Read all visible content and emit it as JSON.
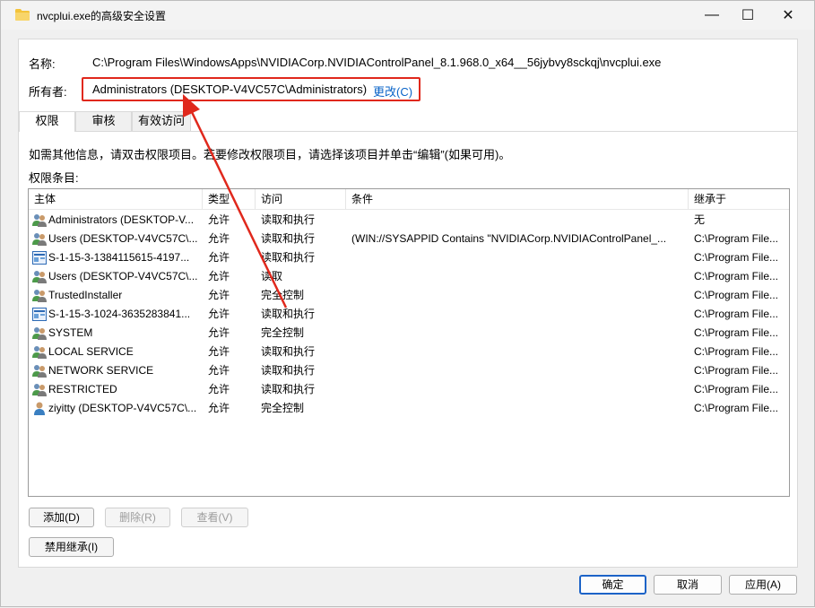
{
  "window": {
    "title": "nvcplui.exe的高级安全设置",
    "minimize": "—",
    "maximize": "☐",
    "close": "✕"
  },
  "header": {
    "name_label": "名称:",
    "name_value": "C:\\Program Files\\WindowsApps\\NVIDIACorp.NVIDIAControlPanel_8.1.968.0_x64__56jybvy8sckqj\\nvcplui.exe",
    "owner_label": "所有者:",
    "owner_value": "Administrators (DESKTOP-V4VC57C\\Administrators)",
    "change_link": "更改(C)"
  },
  "tabs": [
    "权限",
    "审核",
    "有效访问"
  ],
  "info_text": "如需其他信息，请双击权限项目。若要修改权限项目，请选择该项目并单击“编辑”(如果可用)。",
  "entries_label": "权限条目:",
  "table": {
    "columns": [
      "主体",
      "类型",
      "访问",
      "条件",
      "继承于"
    ],
    "rows": [
      {
        "principal": "Administrators (DESKTOP-V...",
        "type": "允许",
        "access": "读取和执行",
        "condition": "",
        "inherited": "无",
        "icon": "group-icon"
      },
      {
        "principal": "Users (DESKTOP-V4VC57C\\...",
        "type": "允许",
        "access": "读取和执行",
        "condition": "(WIN://SYSAPPID Contains \"NVIDIACorp.NVIDIAControlPanel_...",
        "inherited": "C:\\Program File...",
        "icon": "group-icon"
      },
      {
        "principal": "S-1-15-3-1384115615-4197...",
        "type": "允许",
        "access": "读取和执行",
        "condition": "",
        "inherited": "C:\\Program File...",
        "icon": "capability-icon"
      },
      {
        "principal": "Users (DESKTOP-V4VC57C\\...",
        "type": "允许",
        "access": "读取",
        "condition": "",
        "inherited": "C:\\Program File...",
        "icon": "group-icon"
      },
      {
        "principal": "TrustedInstaller",
        "type": "允许",
        "access": "完全控制",
        "condition": "",
        "inherited": "C:\\Program File...",
        "icon": "group-icon"
      },
      {
        "principal": "S-1-15-3-1024-3635283841...",
        "type": "允许",
        "access": "读取和执行",
        "condition": "",
        "inherited": "C:\\Program File...",
        "icon": "capability-icon"
      },
      {
        "principal": "SYSTEM",
        "type": "允许",
        "access": "完全控制",
        "condition": "",
        "inherited": "C:\\Program File...",
        "icon": "group-icon"
      },
      {
        "principal": "LOCAL SERVICE",
        "type": "允许",
        "access": "读取和执行",
        "condition": "",
        "inherited": "C:\\Program File...",
        "icon": "group-icon"
      },
      {
        "principal": "NETWORK SERVICE",
        "type": "允许",
        "access": "读取和执行",
        "condition": "",
        "inherited": "C:\\Program File...",
        "icon": "group-icon"
      },
      {
        "principal": "RESTRICTED",
        "type": "允许",
        "access": "读取和执行",
        "condition": "",
        "inherited": "C:\\Program File...",
        "icon": "group-icon"
      },
      {
        "principal": "ziyitty (DESKTOP-V4VC57C\\...",
        "type": "允许",
        "access": "完全控制",
        "condition": "",
        "inherited": "C:\\Program File...",
        "icon": "user-icon"
      }
    ]
  },
  "buttons": {
    "add": "添加(D)",
    "remove": "删除(R)",
    "view": "查看(V)",
    "disable_inheritance": "禁用继承(I)"
  },
  "footer": {
    "ok": "确定",
    "cancel": "取消",
    "apply": "应用(A)"
  },
  "colors": {
    "annotation_red": "#e0281c",
    "link_blue": "#0a64c8",
    "primary_border": "#1c63c7"
  }
}
